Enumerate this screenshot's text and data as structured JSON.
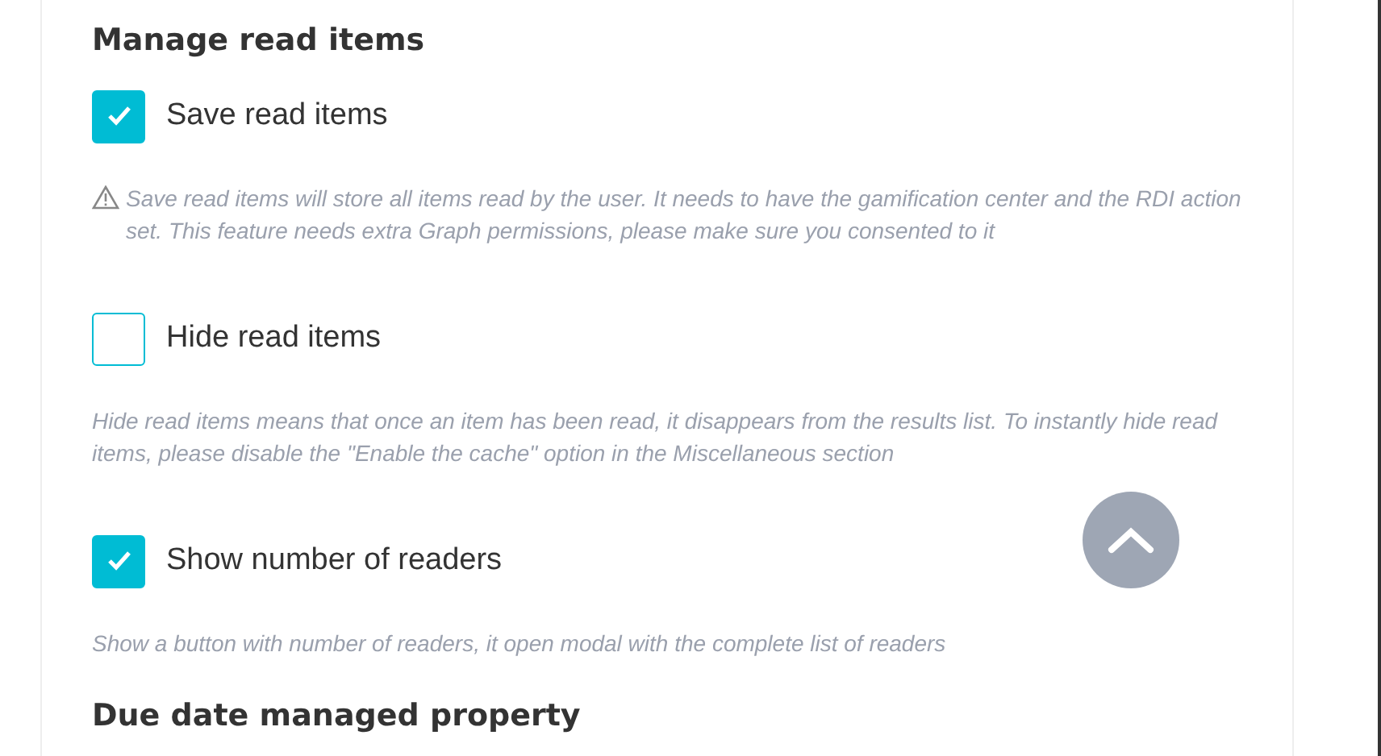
{
  "section_title": "Manage read items",
  "options": [
    {
      "label": "Save read items",
      "checked": true,
      "warning": true,
      "description": "Save read items will store all items read by the user. It needs to have the gamification center and the RDI action set. This feature needs extra Graph permissions, please make sure you consented to it"
    },
    {
      "label": "Hide read items",
      "checked": false,
      "warning": false,
      "description": "Hide read items means that once an item has been read, it disappears from the results list. To instantly hide read items, please disable the \"Enable the cache\" option in the Miscellaneous section"
    },
    {
      "label": "Show number of readers",
      "checked": true,
      "warning": false,
      "description": "Show a button with number of readers, it open modal with the complete list of readers"
    }
  ],
  "next_section_title": "Due date managed property"
}
